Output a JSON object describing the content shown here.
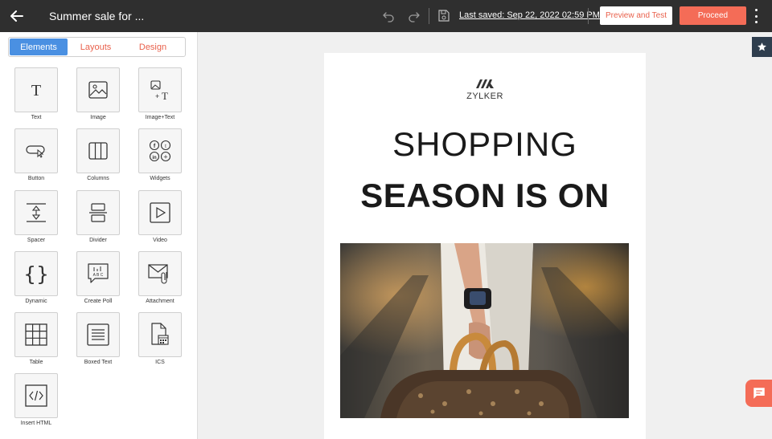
{
  "header": {
    "title": "Summer sale for ...",
    "last_saved": "Last saved: Sep 22, 2022 02:59 PM",
    "preview_label": "Preview and Test",
    "proceed_label": "Proceed",
    "icons": [
      "back-arrow-icon",
      "undo-icon",
      "redo-icon",
      "save-icon",
      "kebab-menu-icon"
    ]
  },
  "tabs": [
    {
      "label": "Elements",
      "active": true
    },
    {
      "label": "Layouts",
      "active": false
    },
    {
      "label": "Design",
      "active": false
    }
  ],
  "elements": [
    {
      "label": "Text",
      "icon": "text-icon"
    },
    {
      "label": "Image",
      "icon": "image-icon"
    },
    {
      "label": "Image+Text",
      "icon": "image-text-icon"
    },
    {
      "label": "Button",
      "icon": "button-icon"
    },
    {
      "label": "Columns",
      "icon": "columns-icon"
    },
    {
      "label": "Widgets",
      "icon": "social-widgets-icon"
    },
    {
      "label": "Spacer",
      "icon": "spacer-icon"
    },
    {
      "label": "Divider",
      "icon": "divider-icon"
    },
    {
      "label": "Video",
      "icon": "video-icon"
    },
    {
      "label": "Dynamic",
      "icon": "curly-braces-icon"
    },
    {
      "label": "Create Poll",
      "icon": "poll-icon"
    },
    {
      "label": "Attachment",
      "icon": "attachment-icon"
    },
    {
      "label": "Table",
      "icon": "table-icon"
    },
    {
      "label": "Boxed Text",
      "icon": "boxed-text-icon"
    },
    {
      "label": "ICS",
      "icon": "calendar-file-icon"
    },
    {
      "label": "Insert HTML",
      "icon": "code-icon"
    }
  ],
  "email": {
    "brand_name": "ZYLKER",
    "headline_line1": "SHOPPING",
    "headline_line2": "SEASON IS ON"
  },
  "colors": {
    "topbar": "#2f2f2f",
    "accent": "#f46c57",
    "tab_active": "#4a90e2"
  }
}
